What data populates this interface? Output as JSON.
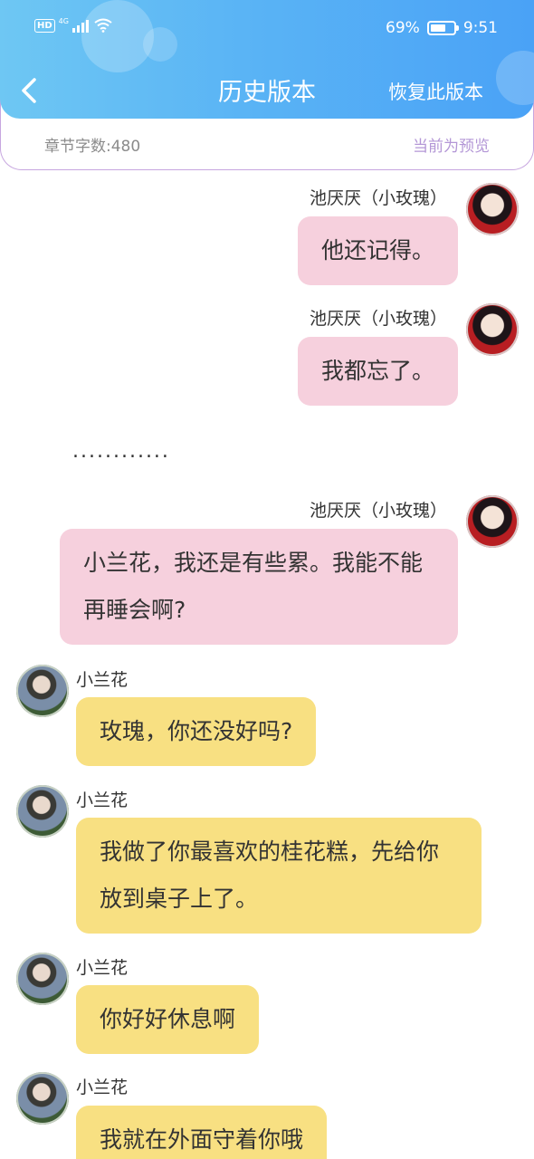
{
  "status_bar": {
    "hd": "HD",
    "signal": "4G",
    "battery": "69%",
    "battery_level": 0.69,
    "time": "9:51"
  },
  "header": {
    "title": "历史版本",
    "restore_label": "恢复此版本"
  },
  "info": {
    "word_count": "章节字数:480",
    "preview_label": "当前为预览"
  },
  "ellipsis": "............",
  "messages": [
    {
      "speaker": "池厌厌（小玫瑰）",
      "text": "他还记得。"
    },
    {
      "speaker": "池厌厌（小玫瑰）",
      "text": "我都忘了。"
    },
    {
      "speaker": "池厌厌（小玫瑰）",
      "text": "小兰花，我还是有些累。我能不能再睡会啊?"
    },
    {
      "speaker": "小兰花",
      "text": "玫瑰，你还没好吗?"
    },
    {
      "speaker": "小兰花",
      "text": "我做了你最喜欢的桂花糕，先给你放到桌子上了。"
    },
    {
      "speaker": "小兰花",
      "text": "你好好休息啊"
    },
    {
      "speaker": "小兰花",
      "text": "我就在外面守着你哦"
    }
  ],
  "colors": {
    "header": "#5ab4f5",
    "pink_bubble": "#f6d0dd",
    "yellow_bubble": "#f8e082",
    "accent": "#b396d6"
  }
}
